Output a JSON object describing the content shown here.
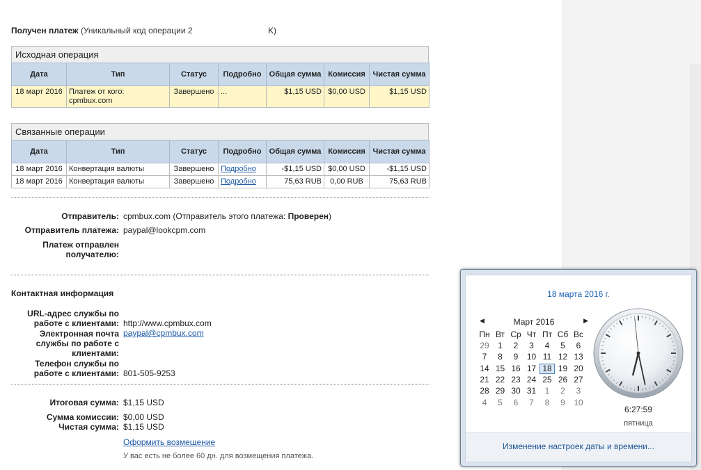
{
  "header": {
    "title_bold": "Получен платеж",
    "title_rest": "(Уникальный код операции 2",
    "title_tail": "K)"
  },
  "columns": [
    "Дата",
    "Тип",
    "Статус",
    "Подробно",
    "Общая сумма",
    "Комиссия",
    "Чистая сумма"
  ],
  "original": {
    "heading": "Исходная операция",
    "rows": [
      {
        "date": "18 март 2016",
        "type": "Платеж от кого: cpmbux.com",
        "status": "Завершено",
        "details": "...",
        "total": "$1,15 USD",
        "fee": "$0,00 USD",
        "net": "$1,15 USD"
      }
    ]
  },
  "related": {
    "heading": "Связанные операции",
    "rows": [
      {
        "date": "18 март 2016",
        "type": "Конвертация валюты",
        "status": "Завершено",
        "details": "Подробно",
        "total": "-$1,15 USD",
        "fee": "$0,00 USD",
        "net": "-$1,15 USD"
      },
      {
        "date": "18 март 2016",
        "type": "Конвертация валюты",
        "status": "Завершено",
        "details": "Подробно",
        "total": "75,63 RUB",
        "fee": "0,00 RUB",
        "net": "75,63 RUB"
      }
    ]
  },
  "sender": {
    "sender_label": "Отправитель:",
    "sender_value": "cpmbux.com",
    "sender_note": "(Отправитель этого платежа:",
    "sender_status": "Проверен",
    "sender_close": ")",
    "payer_label": "Отправитель платежа:",
    "payer_value": "paypal@lookcpm.com",
    "sent_to_label_1": "Платеж отправлен",
    "sent_to_label_2": "получателю:"
  },
  "contact": {
    "heading": "Контактная информация",
    "url_label_1": "URL-адрес службы по",
    "url_label_2": "работе с клиентами:",
    "url_value": "http://www.cpmbux.com",
    "email_label_1": "Электронная почта",
    "email_label_2": "службы по работе с",
    "email_label_3": "клиентами:",
    "email_value": "paypal@cpmbux.com",
    "phone_label_1": "Телефон службы по",
    "phone_label_2": "работе с клиентами:",
    "phone_value": "801-505-9253"
  },
  "totals": {
    "total_label": "Итоговая сумма:",
    "total_value": "$1,15 USD",
    "fee_label": "Сумма комиссии:",
    "fee_value": "$0,00 USD",
    "net_label": "Чистая сумма:",
    "net_value": "$1,15 USD",
    "refund_link": "Оформить возмещение",
    "refund_note": "У вас есть не более 60 дн. для возмещения платежа."
  },
  "calendar": {
    "date_heading": "18 марта 2016 г.",
    "month": "Март 2016",
    "prev": "◀",
    "next": "▶",
    "weekdays": [
      "Пн",
      "Вт",
      "Ср",
      "Чт",
      "Пт",
      "Сб",
      "Вс"
    ],
    "weeks": [
      [
        "29",
        "1",
        "2",
        "3",
        "4",
        "5",
        "6"
      ],
      [
        "7",
        "8",
        "9",
        "10",
        "11",
        "12",
        "13"
      ],
      [
        "14",
        "15",
        "16",
        "17",
        "18",
        "19",
        "20"
      ],
      [
        "21",
        "22",
        "23",
        "24",
        "25",
        "26",
        "27"
      ],
      [
        "28",
        "29",
        "30",
        "31",
        "1",
        "2",
        "3"
      ],
      [
        "4",
        "5",
        "6",
        "7",
        "8",
        "9",
        "10"
      ]
    ],
    "today": "18",
    "time": "6:27:59",
    "weekday": "пятница",
    "clock_hours": 6,
    "clock_minutes": 27,
    "clock_seconds": 59,
    "footer_link": "Изменение настроек даты и времени..."
  },
  "colors": {
    "accent_link": "#1e5aa8",
    "table_header": "#c9d9ea",
    "highlight_row": "#fff6c8"
  }
}
